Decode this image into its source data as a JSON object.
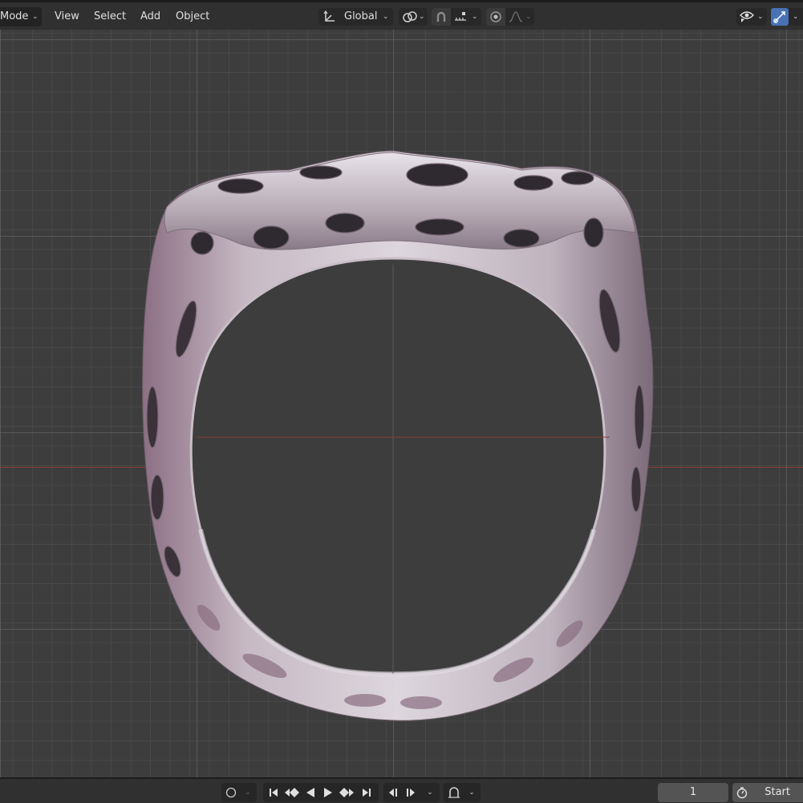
{
  "header": {
    "mode": {
      "label": "Mode",
      "icon": "chevron-down-icon"
    },
    "menus": [
      {
        "label": "View"
      },
      {
        "label": "Select"
      },
      {
        "label": "Add"
      },
      {
        "label": "Object"
      }
    ],
    "transform_orientation": {
      "label": "Global",
      "icon": "orientation-axes-icon"
    },
    "pivot_icon": "pivot-point-icon",
    "snap_icon": "magnet-snap-icon",
    "snap_target_icon": "snap-increment-icon",
    "proportional_icon": "proportional-editing-icon",
    "falloff_icon": "falloff-curve-icon",
    "visibility_icon": "eye-visibility-icon",
    "gizmo_icon": "gizmo-toggle-icon",
    "accent_color": "#4772b3"
  },
  "viewport": {
    "background_color": "#3d3d3d",
    "x_axis_color": "#8a3b3b",
    "object": "ring-mesh"
  },
  "timeline": {
    "current_frame": "1",
    "start_label": "Start",
    "record_icon": "record-circle-icon",
    "playback_icons": [
      "jump-to-start-icon",
      "prev-keyframe-icon",
      "play-reverse-icon",
      "play-icon",
      "next-keyframe-icon",
      "jump-to-end-icon"
    ],
    "step_icons": [
      "step-back-icon",
      "step-forward-icon"
    ],
    "keying_icon": "auto-keying-magnet-icon",
    "stopwatch_icon": "stopwatch-icon"
  }
}
